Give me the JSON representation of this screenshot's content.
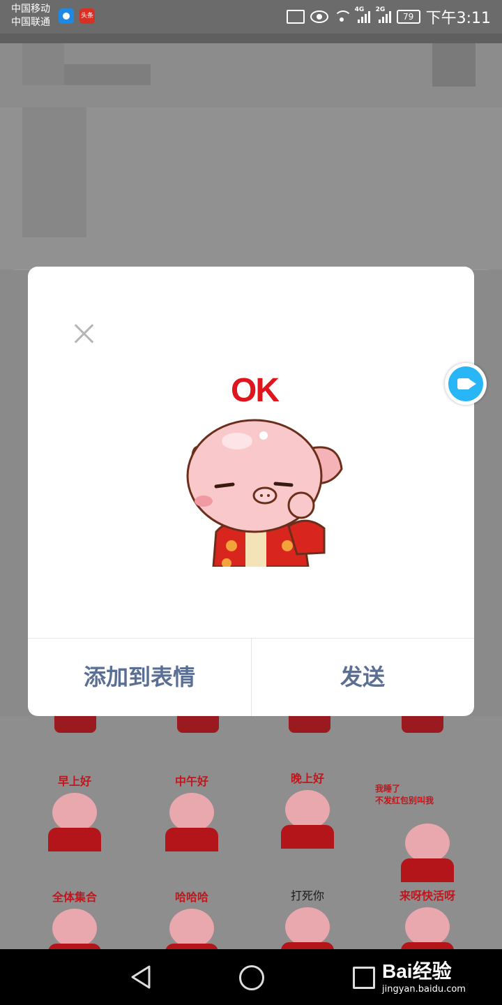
{
  "status_bar": {
    "carriers": [
      "中国移动",
      "中国联通"
    ],
    "app_badge_text": "头条",
    "net_4g": "4G",
    "net_2g": "2G",
    "battery": "79",
    "time": "下午3:11"
  },
  "dialog": {
    "sticker_text": "OK",
    "add_button": "添加到表情",
    "send_button": "发送"
  },
  "sticker_grid": {
    "row1": [
      "早上好",
      "中午好",
      "晚上好",
      "我睡了\n不发红包别叫我"
    ],
    "row2": [
      "全体集合",
      "哈哈哈",
      "打死你",
      "来呀快活呀"
    ]
  },
  "watermark": {
    "brand": "Bai经验",
    "url": "jingyan.baidu.com"
  },
  "icons": {
    "close": "close-icon",
    "camera": "video-camera-icon",
    "back": "nav-back-icon",
    "home": "nav-home-icon",
    "recent": "nav-recent-icon"
  },
  "colors": {
    "sticker_red": "#e0141c",
    "dialog_button": "#5b6e93",
    "camera_blue": "#29b6f6"
  }
}
